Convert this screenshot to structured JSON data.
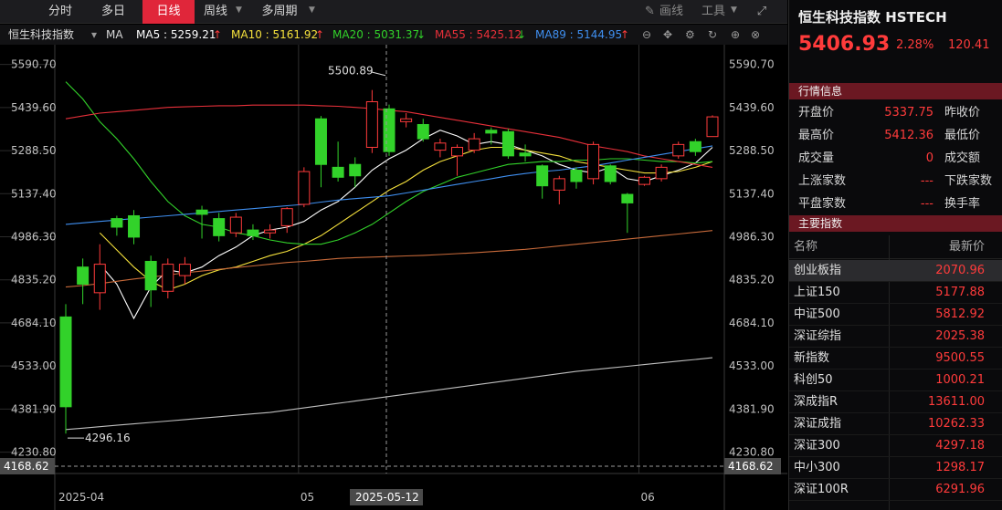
{
  "tabs": [
    {
      "label": "分时",
      "active": false
    },
    {
      "label": "多日",
      "active": false
    },
    {
      "label": "日线",
      "active": true
    },
    {
      "label": "周线",
      "active": false
    },
    {
      "label": "多周期",
      "active": false
    }
  ],
  "toolbar": {
    "draw_label": "画线",
    "tools_label": "工具"
  },
  "ma_bar": {
    "name": "恒生科技指数",
    "ma_label": "MA",
    "ma5": "MA5 : 5259.21",
    "ma10": "MA10 : 5161.92",
    "ma20": "MA20 : 5031.37",
    "ma55": "MA55 : 5425.12",
    "ma89": "MA89 : 5144.95",
    "ma5_arrow": "↑",
    "ma10_arrow": "↑",
    "ma20_arrow": "↓",
    "ma55_arrow": "↓",
    "ma89_arrow": "↑",
    "colors": {
      "ma5": "#ffffff",
      "ma10": "#f5e13c",
      "ma20": "#32d22a",
      "ma55": "#e8303a",
      "ma89": "#3f8ff0"
    }
  },
  "chart_data": {
    "type": "candlestick",
    "y_ticks": [
      "5590.70",
      "5439.60",
      "5288.50",
      "5137.40",
      "4986.30",
      "4835.20",
      "4684.10",
      "4533.00",
      "4381.90",
      "4230.80"
    ],
    "ylim": [
      4168.62,
      5660
    ],
    "x_labels": [
      {
        "label": "2025-04",
        "index": 0
      },
      {
        "label": "05",
        "index": 14
      },
      {
        "label": "06",
        "index": 34
      }
    ],
    "crosshair": {
      "index": 19,
      "label": "2025-05-12",
      "value": "4168.62"
    },
    "high_annotation": {
      "value": "5500.89",
      "index": 19
    },
    "low_annotation": {
      "value": "4296.16",
      "index": 0
    },
    "candles": [
      {
        "o": 4705,
        "c": 4390,
        "h": 4750,
        "l": 4296
      },
      {
        "o": 4880,
        "c": 4820,
        "h": 4910,
        "l": 4750
      },
      {
        "o": 4790,
        "c": 4890,
        "h": 4960,
        "l": 4730
      },
      {
        "o": 5050,
        "c": 5020,
        "h": 5060,
        "l": 4990
      },
      {
        "o": 5060,
        "c": 4985,
        "h": 5080,
        "l": 4960
      },
      {
        "o": 4900,
        "c": 4800,
        "h": 4920,
        "l": 4740
      },
      {
        "o": 4795,
        "c": 4890,
        "h": 4910,
        "l": 4770
      },
      {
        "o": 4850,
        "c": 4890,
        "h": 4915,
        "l": 4820
      },
      {
        "o": 5080,
        "c": 5065,
        "h": 5095,
        "l": 4980
      },
      {
        "o": 5050,
        "c": 4990,
        "h": 5070,
        "l": 4970
      },
      {
        "o": 5000,
        "c": 5055,
        "h": 5070,
        "l": 4985
      },
      {
        "o": 5010,
        "c": 4990,
        "h": 5030,
        "l": 4975
      },
      {
        "o": 5000,
        "c": 5010,
        "h": 5030,
        "l": 4980
      },
      {
        "o": 5025,
        "c": 5085,
        "h": 5090,
        "l": 5000
      },
      {
        "o": 5100,
        "c": 5215,
        "h": 5230,
        "l": 5090
      },
      {
        "o": 5400,
        "c": 5240,
        "h": 5410,
        "l": 5160
      },
      {
        "o": 5230,
        "c": 5195,
        "h": 5320,
        "l": 5180
      },
      {
        "o": 5240,
        "c": 5200,
        "h": 5265,
        "l": 5160
      },
      {
        "o": 5300,
        "c": 5460,
        "h": 5501,
        "l": 5280
      },
      {
        "o": 5435,
        "c": 5285,
        "h": 5450,
        "l": 5270
      },
      {
        "o": 5390,
        "c": 5400,
        "h": 5420,
        "l": 5370
      },
      {
        "o": 5380,
        "c": 5330,
        "h": 5400,
        "l": 5320
      },
      {
        "o": 5290,
        "c": 5315,
        "h": 5330,
        "l": 5265
      },
      {
        "o": 5270,
        "c": 5300,
        "h": 5310,
        "l": 5200
      },
      {
        "o": 5290,
        "c": 5330,
        "h": 5350,
        "l": 5280
      },
      {
        "o": 5360,
        "c": 5350,
        "h": 5370,
        "l": 5310
      },
      {
        "o": 5355,
        "c": 5270,
        "h": 5365,
        "l": 5260
      },
      {
        "o": 5280,
        "c": 5270,
        "h": 5310,
        "l": 5250
      },
      {
        "o": 5235,
        "c": 5165,
        "h": 5240,
        "l": 5120
      },
      {
        "o": 5150,
        "c": 5190,
        "h": 5200,
        "l": 5100
      },
      {
        "o": 5220,
        "c": 5180,
        "h": 5230,
        "l": 5155
      },
      {
        "o": 5190,
        "c": 5310,
        "h": 5320,
        "l": 5170
      },
      {
        "o": 5235,
        "c": 5180,
        "h": 5240,
        "l": 5170
      },
      {
        "o": 5135,
        "c": 5105,
        "h": 5140,
        "l": 5000
      },
      {
        "o": 5170,
        "c": 5195,
        "h": 5200,
        "l": 5165
      },
      {
        "o": 5190,
        "c": 5230,
        "h": 5240,
        "l": 5180
      },
      {
        "o": 5270,
        "c": 5310,
        "h": 5320,
        "l": 5260
      },
      {
        "o": 5320,
        "c": 5285,
        "h": 5330,
        "l": 5270
      },
      {
        "o": 5337.75,
        "c": 5406.93,
        "h": 5412.36,
        "l": 5337
      }
    ],
    "ma_lines": [
      {
        "name": "MA5",
        "color": "#ffffff",
        "values": [
          null,
          null,
          4890,
          4820,
          4700,
          4810,
          4870,
          4860,
          4880,
          4920,
          4950,
          4990,
          5010,
          5020,
          5040,
          5080,
          5110,
          5160,
          5220,
          5260,
          5290,
          5330,
          5360,
          5340,
          5310,
          5320,
          5310,
          5290,
          5270,
          5240,
          5220,
          5210,
          5230,
          5190,
          5180,
          5200,
          5220,
          5245,
          5300
        ]
      },
      {
        "name": "MA10",
        "color": "#f5e13c",
        "values": [
          null,
          null,
          5000,
          4940,
          4880,
          4830,
          4800,
          4820,
          4850,
          4870,
          4880,
          4900,
          4920,
          4935,
          4960,
          4990,
          5030,
          5070,
          5110,
          5150,
          5180,
          5220,
          5250,
          5270,
          5290,
          5300,
          5300,
          5290,
          5280,
          5270,
          5250,
          5240,
          5230,
          5220,
          5210,
          5210,
          5215,
          5230,
          5250
        ]
      },
      {
        "name": "MA20",
        "color": "#32d22a",
        "values": [
          5530,
          5470,
          5390,
          5330,
          5260,
          5180,
          5110,
          5060,
          5030,
          5020,
          5000,
          4990,
          4975,
          4965,
          4960,
          4960,
          4975,
          5000,
          5030,
          5070,
          5110,
          5145,
          5170,
          5195,
          5210,
          5225,
          5240,
          5245,
          5250,
          5250,
          5255,
          5255,
          5260,
          5260,
          5255,
          5250,
          5250,
          5245,
          5250
        ]
      },
      {
        "name": "MA55",
        "color": "#e8303a",
        "values": [
          5400,
          5410,
          5420,
          5425,
          5430,
          5435,
          5440,
          5442,
          5444,
          5446,
          5446,
          5448,
          5448,
          5448,
          5448,
          5446,
          5444,
          5440,
          5436,
          5430,
          5425,
          5415,
          5405,
          5395,
          5385,
          5375,
          5365,
          5355,
          5345,
          5335,
          5320,
          5305,
          5295,
          5285,
          5270,
          5260,
          5250,
          5240,
          5230
        ]
      },
      {
        "name": "MA89",
        "color": "#3f8ff0",
        "values": [
          5030,
          5035,
          5040,
          5045,
          5050,
          5055,
          5060,
          5065,
          5070,
          5075,
          5080,
          5085,
          5090,
          5095,
          5100,
          5108,
          5115,
          5120,
          5125,
          5130,
          5140,
          5150,
          5160,
          5170,
          5180,
          5190,
          5200,
          5208,
          5215,
          5220,
          5228,
          5235,
          5245,
          5255,
          5265,
          5275,
          5285,
          5295,
          5305
        ]
      },
      {
        "name": "MA144",
        "color": "#c86a3a",
        "values": [
          4810,
          4815,
          4822,
          4830,
          4838,
          4845,
          4852,
          4860,
          4866,
          4872,
          4878,
          4884,
          4890,
          4896,
          4900,
          4905,
          4910,
          4913,
          4915,
          4917,
          4919,
          4921,
          4924,
          4927,
          4930,
          4934,
          4938,
          4942,
          4948,
          4954,
          4960,
          4966,
          4972,
          4978,
          4984,
          4990,
          4996,
          5002,
          5008
        ]
      },
      {
        "name": "MA250",
        "color": "#bfbfbf",
        "values": [
          4310,
          4315,
          4320,
          4325,
          4330,
          4335,
          4340,
          4345,
          4350,
          4355,
          4360,
          4365,
          4370,
          4378,
          4386,
          4394,
          4402,
          4410,
          4418,
          4426,
          4434,
          4442,
          4450,
          4458,
          4466,
          4474,
          4482,
          4490,
          4498,
          4506,
          4514,
          4520,
          4526,
          4532,
          4538,
          4544,
          4550,
          4556,
          4562
        ]
      }
    ]
  },
  "panel": {
    "title": "恒生科技指数 HSTECH",
    "price": "5406.93",
    "change_pct": "2.28%",
    "change": "120.41",
    "quote_header": "行情信息",
    "quotes": [
      {
        "l1": "开盘价",
        "v1": "5337.75",
        "l2": "昨收价"
      },
      {
        "l1": "最高价",
        "v1": "5412.36",
        "l2": "最低价"
      },
      {
        "l1": "成交量",
        "v1": "0",
        "l2": "成交额"
      },
      {
        "l1": "上涨家数",
        "v1": "---",
        "l2": "下跌家数"
      },
      {
        "l1": "平盘家数",
        "v1": "---",
        "l2": "换手率"
      }
    ],
    "index_header": "主要指数",
    "col_name": "名称",
    "col_price": "最新价",
    "indices": [
      {
        "name": "创业板指",
        "price": "2070.96"
      },
      {
        "name": "上证150",
        "price": "5177.88"
      },
      {
        "name": "中证500",
        "price": "5812.92"
      },
      {
        "name": "深证综指",
        "price": "2025.38"
      },
      {
        "name": "新指数",
        "price": "9500.55"
      },
      {
        "name": "科创50",
        "price": "1000.21"
      },
      {
        "name": "深成指R",
        "price": "13611.00"
      },
      {
        "name": "深证成指",
        "price": "10262.33"
      },
      {
        "name": "深证300",
        "price": "4297.18"
      },
      {
        "name": "中小300",
        "price": "1298.17"
      },
      {
        "name": "深证100R",
        "price": "6291.96"
      }
    ]
  }
}
